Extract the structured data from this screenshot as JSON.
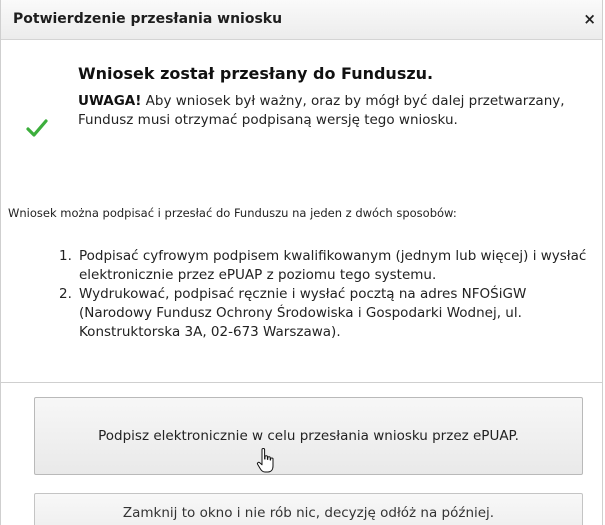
{
  "dialog": {
    "title": "Potwierdzenie przesłania wniosku",
    "close_glyph": "×",
    "close_icon": "close-icon"
  },
  "message": {
    "icon": "checkmark-icon",
    "icon_color": "#3cae3c",
    "heading": "Wniosek został przesłany do Funduszu.",
    "warning_label": "UWAGA!",
    "warning_text": " Aby wniosek był ważny, oraz by mógł być dalej przetwarzany, Fundusz musi otrzymać podpisaną wersję tego wniosku."
  },
  "instructions": {
    "intro": "Wniosek można podpisać i przesłać do Funduszu na jeden z dwóch sposobów:",
    "steps": [
      {
        "num": "1.",
        "text": "Podpisać cyfrowym podpisem kwalifikowanym (jednym lub więcej) i wysłać elektronicznie przez ePUAP z poziomu tego systemu."
      },
      {
        "num": "2.",
        "text": "Wydrukować, podpisać ręcznie i wysłać pocztą na adres NFOŚiGW (Narodowy Fundusz Ochrony Środowiska i Gospodarki Wodnej, ul. Konstruktorska 3A, 02-673 Warszawa)."
      }
    ]
  },
  "buttons": {
    "sign_label": "Podpisz elektronicznie w celu przesłania wniosku przez ePUAP.",
    "close_label": "Zamknij to okno i nie rób nic, decyzję odłóż na później."
  },
  "pointer": {
    "icon": "hand-cursor-icon"
  }
}
